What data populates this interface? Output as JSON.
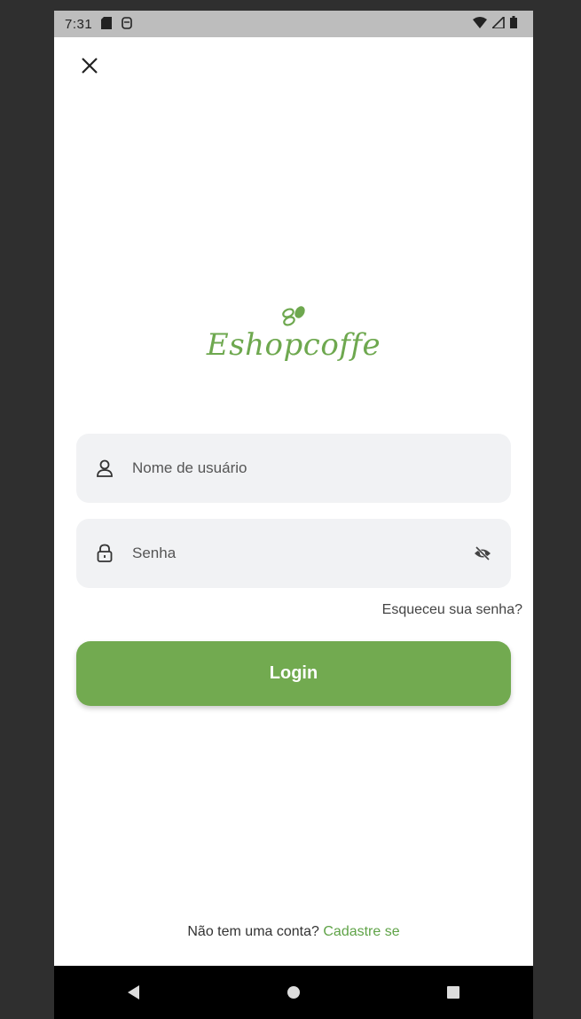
{
  "status_bar": {
    "time": "7:31",
    "icons": [
      "sd-card-icon",
      "alarm-icon",
      "wifi-icon",
      "signal-icon",
      "battery-icon"
    ]
  },
  "header": {
    "close_icon": "close-icon"
  },
  "logo": {
    "text": "Eshopcoffe",
    "color": "#6ea84f"
  },
  "form": {
    "username": {
      "placeholder": "Nome de usuário",
      "value": "",
      "icon": "user-icon"
    },
    "password": {
      "placeholder": "Senha",
      "value": "",
      "icon": "lock-icon",
      "toggle_icon": "eye-off-icon"
    },
    "forgot_label": "Esqueceu sua senha?",
    "login_label": "Login"
  },
  "footer": {
    "prompt": "Não tem uma conta?",
    "signup_label": "Cadastre se"
  },
  "nav_bar": {
    "icons": [
      "back-icon",
      "home-icon",
      "recents-icon"
    ]
  },
  "colors": {
    "accent": "#72aa50",
    "field_bg": "#f1f2f4",
    "status_bar_bg": "#bdbdbd"
  }
}
